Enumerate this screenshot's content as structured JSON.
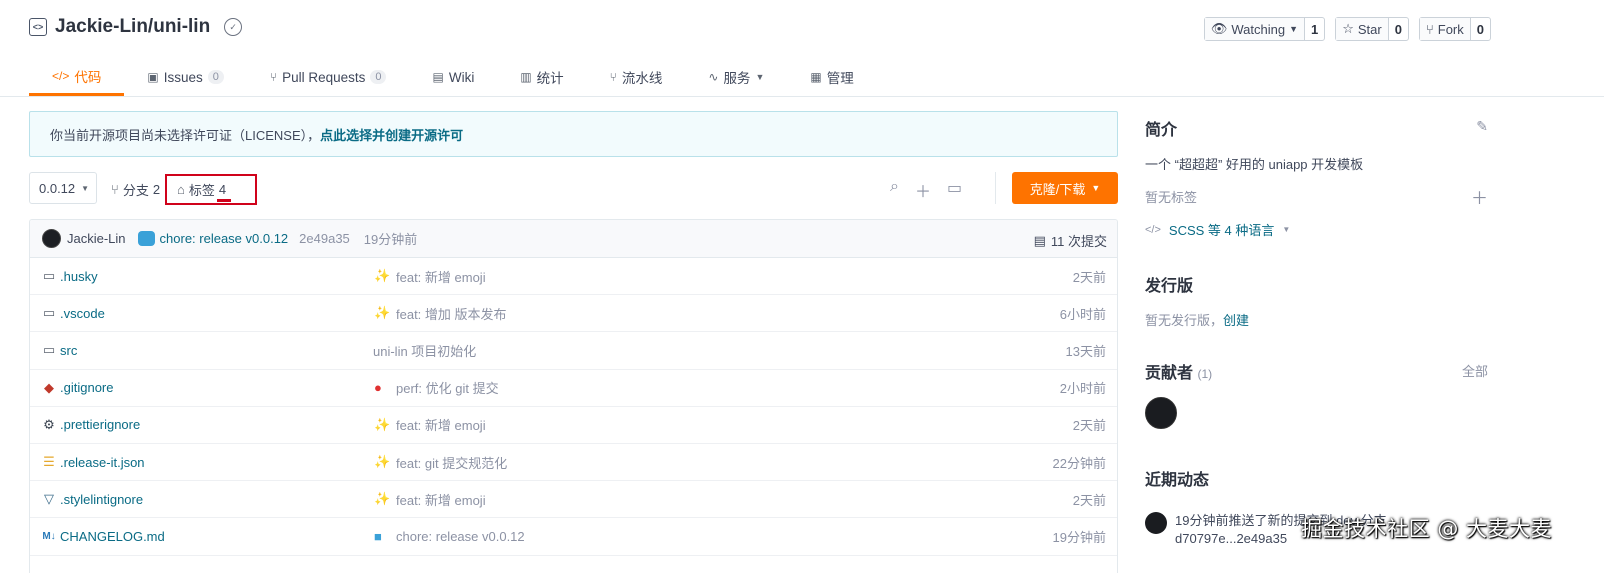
{
  "repo": {
    "icon": "repo-code-icon",
    "name": "Jackie-Lin/uni-lin",
    "badge_icon": "verified-badge-icon"
  },
  "actions": [
    {
      "icon": "eye-icon",
      "label": "Watching",
      "count": "1"
    },
    {
      "icon": "star-icon",
      "label": "Star",
      "count": "0"
    },
    {
      "icon": "fork-icon",
      "label": "Fork",
      "count": "0"
    }
  ],
  "tabs": [
    {
      "icon": "code-icon",
      "label": "代码",
      "active": true
    },
    {
      "icon": "issues-icon",
      "label": "Issues",
      "count": "0"
    },
    {
      "icon": "pull-request-icon",
      "label": "Pull Requests",
      "count": "0"
    },
    {
      "icon": "wiki-icon",
      "label": "Wiki"
    },
    {
      "icon": "stats-icon",
      "label": "统计"
    },
    {
      "icon": "pipeline-icon",
      "label": "流水线"
    },
    {
      "icon": "service-icon",
      "label": "服务"
    },
    {
      "icon": "manage-icon",
      "label": "管理"
    }
  ],
  "license": {
    "text": "你当前开源项目尚未选择许可证（LICENSE），",
    "link": "点此选择并创建开源许可"
  },
  "toolbar": {
    "branch": "0.0.12",
    "branch_label": "分支",
    "branch_count": "2",
    "tag_label": "标签",
    "tag_count": "4",
    "clone_label": "克隆/下载"
  },
  "commit": {
    "author": "Jackie-Lin",
    "message": "chore: release v0.0.12",
    "hash": "2e49a35",
    "time": "19分钟前",
    "count_label": "11 次提交"
  },
  "files": [
    {
      "icon": "folder-icon",
      "name": ".husky",
      "emoji": "sparkle-emoji",
      "msg": "feat: 新增 emoji",
      "time": "2天前"
    },
    {
      "icon": "folder-icon",
      "name": ".vscode",
      "emoji": "sparkle-emoji",
      "msg": "feat: 增加 版本发布",
      "time": "6小时前"
    },
    {
      "icon": "folder-icon",
      "name": "src",
      "emoji": "",
      "msg": "uni-lin 项目初始化",
      "time": "13天前"
    },
    {
      "icon": "git-icon",
      "name": ".gitignore",
      "emoji": "balloon-emoji",
      "msg": "perf: 优化 git 提交",
      "time": "2小时前"
    },
    {
      "icon": "gear-icon",
      "name": ".prettierignore",
      "emoji": "sparkle-emoji",
      "msg": "feat: 新增 emoji",
      "time": "2天前"
    },
    {
      "icon": "json-icon",
      "name": ".release-it.json",
      "emoji": "sparkle-emoji",
      "msg": "feat: git 提交规范化",
      "time": "22分钟前"
    },
    {
      "icon": "stylelint-icon",
      "name": ".stylelintignore",
      "emoji": "sparkle-emoji",
      "msg": "feat: 新增 emoji",
      "time": "2天前"
    },
    {
      "icon": "markdown-icon",
      "name": "CHANGELOG.md",
      "emoji": "release-emoji",
      "msg": "chore: release v0.0.12",
      "time": "19分钟前"
    }
  ],
  "sidebar": {
    "intro_title": "简介",
    "intro_text": "一个 “超超超” 好用的 uniapp 开发模板",
    "no_tags": "暂无标签",
    "languages": "SCSS 等 4 种语言",
    "release_title": "发行版",
    "no_release": "暂无发行版，",
    "create_link": "创建",
    "contrib_title": "贡献者",
    "contrib_count": "(1)",
    "all_label": "全部",
    "activity_title": "近期动态",
    "activity_text": "19分钟前推送了新的提交到 dev 分支，d70797e...2e49a35"
  },
  "watermark": "掘金技术社区 @ 大麦大麦"
}
